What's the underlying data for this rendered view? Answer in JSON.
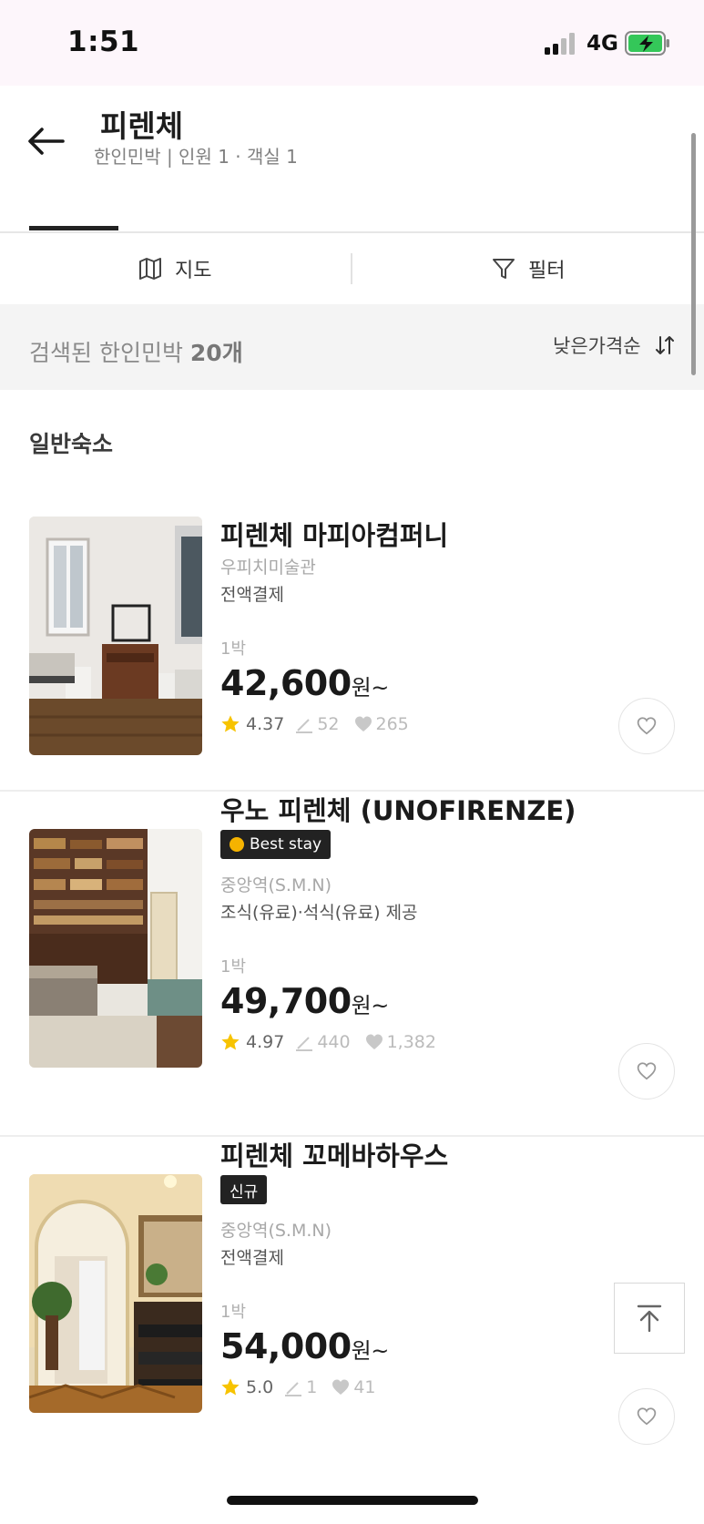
{
  "status": {
    "time": "1:51",
    "network": "4G"
  },
  "header": {
    "title": "피렌체",
    "subtitle": "한인민박 | 인원 1 · 객실 1"
  },
  "toolbar": {
    "map_label": "지도",
    "filter_label": "필터"
  },
  "results": {
    "prefix": "검색된 한인민박 ",
    "count": "20개",
    "sort_label": "낮은가격순"
  },
  "section": {
    "title": "일반숙소"
  },
  "listings": [
    {
      "name": "피렌체 마피아컴퍼니",
      "badge": "",
      "location": "우피치미술관",
      "payment": "전액결제",
      "nights": "1박",
      "price": "42,600",
      "unit": "원~",
      "rating": "4.37",
      "reviews": "52",
      "likes": "265"
    },
    {
      "name": "우노 피렌체 (UNOFIRENZE)",
      "badge": "Best stay",
      "location": "중앙역(S.M.N)",
      "payment": "조식(유료)·석식(유료) 제공",
      "nights": "1박",
      "price": "49,700",
      "unit": "원~",
      "rating": "4.97",
      "reviews": "440",
      "likes": "1,382"
    },
    {
      "name": "피렌체 꼬메바하우스",
      "badge": "신규",
      "location": "중앙역(S.M.N)",
      "payment": "전액결제",
      "nights": "1박",
      "price": "54,000",
      "unit": "원~",
      "rating": "5.0",
      "reviews": "1",
      "likes": "41"
    }
  ],
  "colors": {
    "status_bg": "#fdf6fb",
    "battery_green": "#34c759",
    "star": "#f7c300",
    "badge_bg": "#222222"
  },
  "icons": {
    "back": "arrow-left-icon",
    "map": "map-icon",
    "filter": "funnel-icon",
    "sort": "sort-arrows-icon",
    "heart": "heart-icon",
    "star": "star-icon",
    "pencil": "pencil-icon",
    "scroll_top": "arrow-up-to-line-icon"
  }
}
